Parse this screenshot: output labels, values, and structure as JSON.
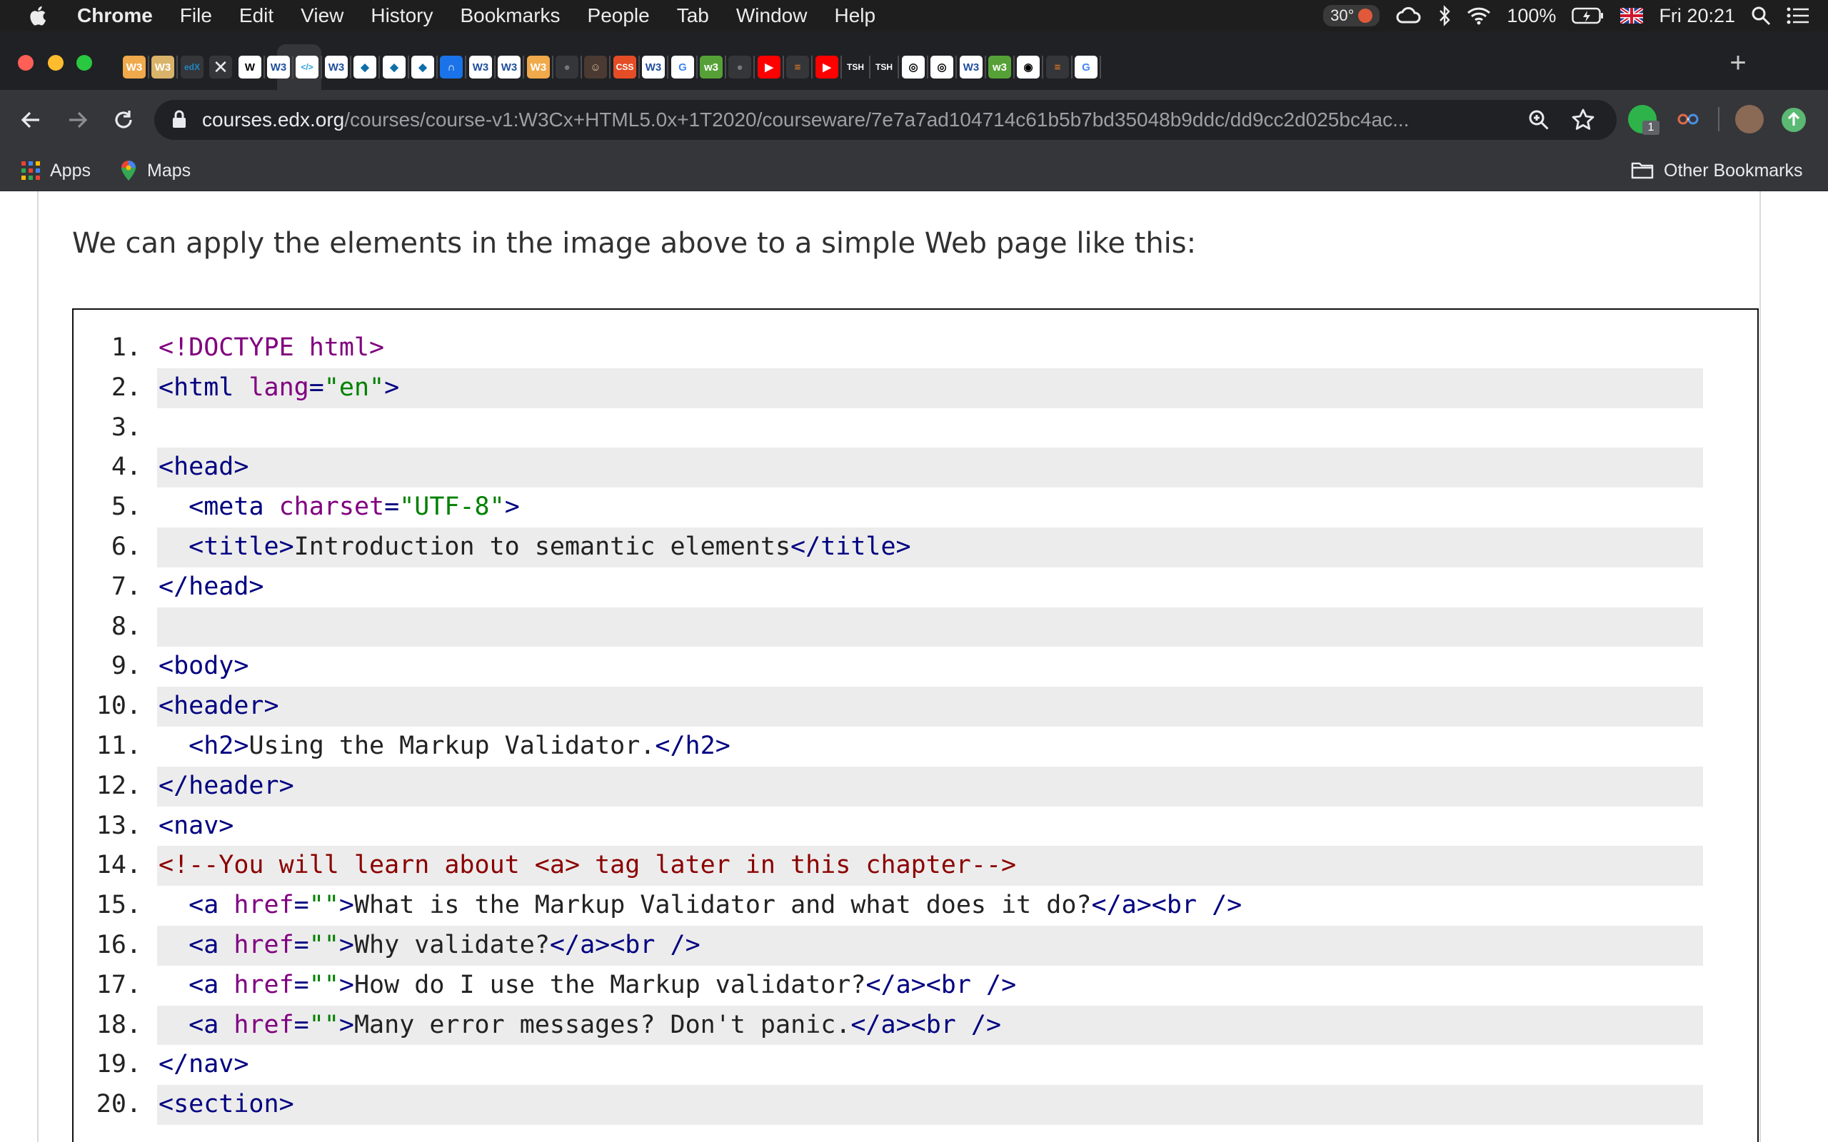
{
  "menubar": {
    "app_name": "Chrome",
    "items": [
      "File",
      "Edit",
      "View",
      "History",
      "Bookmarks",
      "People",
      "Tab",
      "Window",
      "Help"
    ],
    "status": {
      "temperature": "30°",
      "battery": "100%",
      "datetime": "Fri 20:21"
    }
  },
  "tabs": {
    "favicons": [
      {
        "label": "W3",
        "color": "#f0a94b",
        "fg": "#ffffff"
      },
      {
        "label": "W3",
        "color": "#d9b36a",
        "fg": "#ffffff"
      },
      {
        "label": "edX",
        "color": "#35363a",
        "fg": "#1f87c5"
      },
      {
        "label": "✕",
        "color": "#35363a",
        "fg": "#e8eaed"
      },
      {
        "label": "W",
        "color": "#ffffff",
        "fg": "#000000"
      },
      {
        "label": "W3",
        "color": "#ffffff",
        "fg": "#1f4e9c"
      },
      {
        "label": "</>",
        "color": "#ffffff",
        "fg": "#28a0d8"
      },
      {
        "label": "W3",
        "color": "#ffffff",
        "fg": "#1f4e9c"
      },
      {
        "label": "◆",
        "color": "#ffffff",
        "fg": "#0e6fa8"
      },
      {
        "label": "◆",
        "color": "#ffffff",
        "fg": "#0e6fa8"
      },
      {
        "label": "◆",
        "color": "#ffffff",
        "fg": "#0e6fa8"
      },
      {
        "label": "∩",
        "color": "#1a73e8",
        "fg": "#ffffff"
      },
      {
        "label": "W3",
        "color": "#ffffff",
        "fg": "#1f4e9c"
      },
      {
        "label": "W3",
        "color": "#ffffff",
        "fg": "#1f4e9c"
      },
      {
        "label": "W3",
        "color": "#f0a94b",
        "fg": "#ffffff"
      },
      {
        "label": "●",
        "color": "#35363a",
        "fg": "#777777"
      },
      {
        "label": "☺",
        "color": "#4a3a32",
        "fg": "#e0c0a0"
      },
      {
        "label": "CSS",
        "color": "#e44d26",
        "fg": "#ffffff"
      },
      {
        "label": "W3",
        "color": "#ffffff",
        "fg": "#1f4e9c"
      },
      {
        "label": "G",
        "color": "#ffffff",
        "fg": "#4285f4"
      },
      {
        "label": "w3",
        "color": "#56a137",
        "fg": "#ffffff"
      },
      {
        "label": "●",
        "color": "#35363a",
        "fg": "#777777"
      },
      {
        "label": "▶",
        "color": "#ff0000",
        "fg": "#ffffff"
      },
      {
        "label": "≡",
        "color": "#35363a",
        "fg": "#f48024"
      },
      {
        "label": "▶",
        "color": "#ff0000",
        "fg": "#ffffff"
      },
      {
        "label": "TSH",
        "color": "#202124",
        "fg": "#ffffff"
      },
      {
        "label": "TSH",
        "color": "#202124",
        "fg": "#ffffff"
      },
      {
        "label": "◎",
        "color": "#ffffff",
        "fg": "#000000"
      },
      {
        "label": "◎",
        "color": "#ffffff",
        "fg": "#000000"
      },
      {
        "label": "W3",
        "color": "#ffffff",
        "fg": "#1f4e9c"
      },
      {
        "label": "w3",
        "color": "#56a137",
        "fg": "#ffffff"
      },
      {
        "label": "◉",
        "color": "#ffffff",
        "fg": "#000000"
      },
      {
        "label": "≡",
        "color": "#35363a",
        "fg": "#f48024"
      },
      {
        "label": "G",
        "color": "#ffffff",
        "fg": "#4285f4"
      }
    ],
    "new_tab_label": "+"
  },
  "address_bar": {
    "host": "courses.edx.org",
    "path": "/courses/course-v1:W3Cx+HTML5.0x+1T2020/courseware/7e7a7ad104714c61b5b7bd35048b9ddc/dd9cc2d025bc4ac..."
  },
  "extensions": {
    "badge_count": "1"
  },
  "bookmarks_bar": {
    "apps_label": "Apps",
    "maps_label": "Maps",
    "other_label": "Other Bookmarks"
  },
  "content": {
    "intro_text": "We can apply the elements in the image above to a simple Web page like this:",
    "code_lines": [
      {
        "num": "1.",
        "indent": "",
        "tokens": [
          {
            "t": "d",
            "s": "<!DOCTYPE html>"
          }
        ]
      },
      {
        "num": "2.",
        "indent": "",
        "tokens": [
          {
            "t": "t",
            "s": "<html "
          },
          {
            "t": "a",
            "s": "lang"
          },
          {
            "t": "t",
            "s": "="
          },
          {
            "t": "v",
            "s": "\"en\""
          },
          {
            "t": "t",
            "s": ">"
          }
        ]
      },
      {
        "num": "3.",
        "indent": "",
        "tokens": []
      },
      {
        "num": "4.",
        "indent": "",
        "tokens": [
          {
            "t": "t",
            "s": "<head>"
          }
        ]
      },
      {
        "num": "5.",
        "indent": "  ",
        "tokens": [
          {
            "t": "t",
            "s": "<meta "
          },
          {
            "t": "a",
            "s": "charset"
          },
          {
            "t": "t",
            "s": "="
          },
          {
            "t": "v",
            "s": "\"UTF-8\""
          },
          {
            "t": "t",
            "s": ">"
          }
        ]
      },
      {
        "num": "6.",
        "indent": "  ",
        "tokens": [
          {
            "t": "t",
            "s": "<title>"
          },
          {
            "t": "x",
            "s": "Introduction to semantic elements"
          },
          {
            "t": "t",
            "s": "</title>"
          }
        ]
      },
      {
        "num": "7.",
        "indent": "",
        "tokens": [
          {
            "t": "t",
            "s": "</head>"
          }
        ]
      },
      {
        "num": "8.",
        "indent": "",
        "tokens": []
      },
      {
        "num": "9.",
        "indent": "",
        "tokens": [
          {
            "t": "t",
            "s": "<body>"
          }
        ]
      },
      {
        "num": "10.",
        "indent": "",
        "tokens": [
          {
            "t": "t",
            "s": "<header>"
          }
        ]
      },
      {
        "num": "11.",
        "indent": "  ",
        "tokens": [
          {
            "t": "t",
            "s": "<h2>"
          },
          {
            "t": "x",
            "s": "Using the Markup Validator."
          },
          {
            "t": "t",
            "s": "</h2>"
          }
        ]
      },
      {
        "num": "12.",
        "indent": "",
        "tokens": [
          {
            "t": "t",
            "s": "</header>"
          }
        ]
      },
      {
        "num": "13.",
        "indent": "",
        "tokens": [
          {
            "t": "t",
            "s": "<nav>"
          }
        ]
      },
      {
        "num": "14.",
        "indent": "",
        "tokens": [
          {
            "t": "c",
            "s": "<!--You will learn about <a> tag later in this chapter-->"
          }
        ]
      },
      {
        "num": "15.",
        "indent": "  ",
        "tokens": [
          {
            "t": "t",
            "s": "<a "
          },
          {
            "t": "a",
            "s": "href"
          },
          {
            "t": "t",
            "s": "="
          },
          {
            "t": "v",
            "s": "\"\""
          },
          {
            "t": "t",
            "s": ">"
          },
          {
            "t": "x",
            "s": "What is the Markup Validator and what does it do?"
          },
          {
            "t": "t",
            "s": "</a><br />"
          }
        ]
      },
      {
        "num": "16.",
        "indent": "  ",
        "tokens": [
          {
            "t": "t",
            "s": "<a "
          },
          {
            "t": "a",
            "s": "href"
          },
          {
            "t": "t",
            "s": "="
          },
          {
            "t": "v",
            "s": "\"\""
          },
          {
            "t": "t",
            "s": ">"
          },
          {
            "t": "x",
            "s": "Why validate?"
          },
          {
            "t": "t",
            "s": "</a><br />"
          }
        ]
      },
      {
        "num": "17.",
        "indent": "  ",
        "tokens": [
          {
            "t": "t",
            "s": "<a "
          },
          {
            "t": "a",
            "s": "href"
          },
          {
            "t": "t",
            "s": "="
          },
          {
            "t": "v",
            "s": "\"\""
          },
          {
            "t": "t",
            "s": ">"
          },
          {
            "t": "x",
            "s": "How do I use the Markup validator?"
          },
          {
            "t": "t",
            "s": "</a><br />"
          }
        ]
      },
      {
        "num": "18.",
        "indent": "  ",
        "tokens": [
          {
            "t": "t",
            "s": "<a "
          },
          {
            "t": "a",
            "s": "href"
          },
          {
            "t": "t",
            "s": "="
          },
          {
            "t": "v",
            "s": "\"\""
          },
          {
            "t": "t",
            "s": ">"
          },
          {
            "t": "x",
            "s": "Many error messages? Don't panic."
          },
          {
            "t": "t",
            "s": "</a><br />"
          }
        ]
      },
      {
        "num": "19.",
        "indent": "",
        "tokens": [
          {
            "t": "t",
            "s": "</nav>"
          }
        ]
      },
      {
        "num": "20.",
        "indent": "",
        "tokens": [
          {
            "t": "t",
            "s": "<section>"
          }
        ]
      }
    ]
  },
  "colors": {
    "tag": "#000080",
    "attribute": "#800080",
    "value": "#008000",
    "comment": "#8b0000",
    "line_highlight": "#ececec"
  }
}
